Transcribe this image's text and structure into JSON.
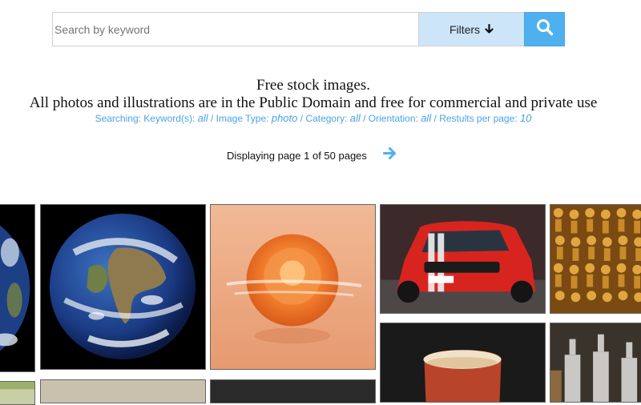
{
  "search": {
    "placeholder": "Search by keyword",
    "value": "",
    "filters_label": "Filters"
  },
  "header": {
    "line1": "Free stock images.",
    "line2": "All photos and illustrations are in the Public Domain and free for commercial and private use"
  },
  "params": {
    "keyword_label": "Searching: Keyword(s):",
    "keyword_value": "all",
    "image_type_label": "/ Image Type:",
    "image_type_value": "photo",
    "category_label": "/ Category:",
    "category_value": "all",
    "orientation_label": "/ Orientation:",
    "orientation_value": "all",
    "results_label": "/ Restults per page:",
    "results_value": "10"
  },
  "pagination": {
    "text": "Displaying page 1 of 50 pages",
    "current_page": 1,
    "total_pages": 50
  },
  "icons": {
    "filters": "arrow-down-icon",
    "search": "search-icon",
    "next": "arrow-right-icon"
  },
  "colors": {
    "accent": "#4fb0ef",
    "filters_bg": "#cde5f8",
    "param_text": "#4aa3e6"
  },
  "gallery": {
    "images": [
      {
        "subject": "earth-partial"
      },
      {
        "subject": "earth-globe"
      },
      {
        "subject": "orange-dahlia-flower"
      },
      {
        "subject": "red-pickup-truck"
      },
      {
        "subject": "wooden-figurines"
      },
      {
        "subject": "beer-glass"
      },
      {
        "subject": "glass-bottles"
      }
    ]
  }
}
